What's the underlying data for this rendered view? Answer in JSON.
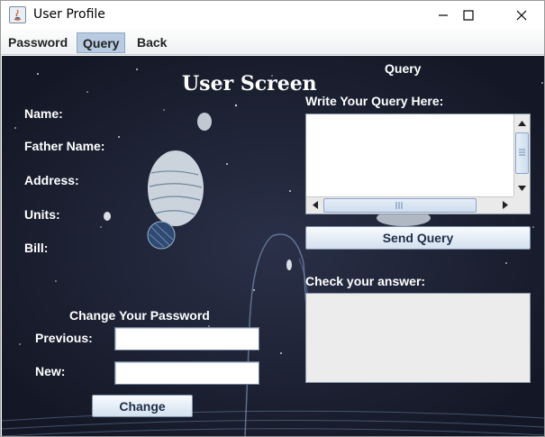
{
  "window": {
    "title": "User Profile"
  },
  "menu": {
    "items": [
      {
        "label": "Password"
      },
      {
        "label": "Query"
      },
      {
        "label": "Back"
      }
    ],
    "active_index": 1
  },
  "profile": {
    "screen_title": "User Screen",
    "fields": [
      {
        "label": "Name:"
      },
      {
        "label": "Father Name:"
      },
      {
        "label": "Address:"
      },
      {
        "label": "Units:"
      },
      {
        "label": "Bill:"
      }
    ]
  },
  "query_panel": {
    "heading": "Query",
    "write_label": "Write Your Query Here:",
    "query_value": "",
    "send_button": "Send Query",
    "answer_label": "Check your answer:",
    "answer_value": ""
  },
  "password_panel": {
    "heading": "Change Your Password",
    "previous_label": "Previous:",
    "previous_value": "",
    "new_label": "New:",
    "new_value": "",
    "change_button": "Change"
  },
  "colors": {
    "background": "#1b2030",
    "label_text": "#ffffff",
    "active_menu": "#b8cbe0",
    "button_text": "#20304a"
  }
}
